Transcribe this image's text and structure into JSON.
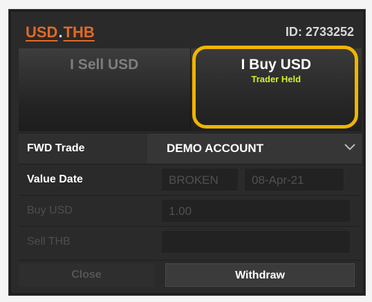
{
  "header": {
    "pair_base": "USD",
    "pair_sep": ".",
    "pair_quote": "THB",
    "id_text": "ID: 2733252"
  },
  "sides": {
    "sell_label": "I Sell USD",
    "buy_label": "I Buy USD",
    "buy_sub": "Trader Held"
  },
  "form": {
    "trade_type_label": "FWD Trade",
    "account_value": "DEMO ACCOUNT",
    "value_date_label": "Value Date",
    "value_date_type": "BROKEN",
    "value_date": "08-Apr-21",
    "buy_label": "Buy USD",
    "buy_amount": "1.00",
    "sell_label": "Sell THB",
    "sell_amount": ""
  },
  "buttons": {
    "close_label": "Close",
    "withdraw_label": "Withdraw"
  },
  "colors": {
    "accent_orange": "#e06a28",
    "highlight": "#f0b400",
    "status_green": "#d8ef2a"
  }
}
